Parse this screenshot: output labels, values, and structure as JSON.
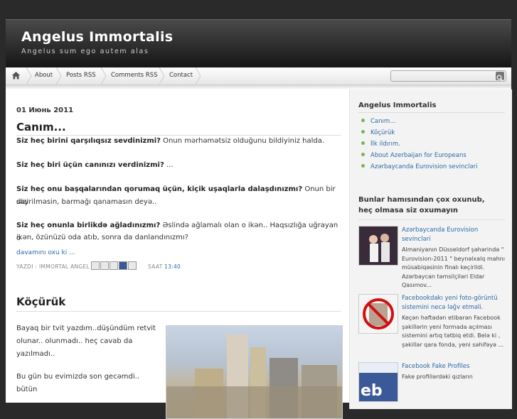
{
  "site": {
    "title": "Angelus Immortalis",
    "tagline": "Angelus sum ego autem alas"
  },
  "nav": {
    "home_icon": "home-icon",
    "items": [
      "About",
      "Posts RSS",
      "Comments RSS",
      "Contact"
    ],
    "search_placeholder": ""
  },
  "posts": [
    {
      "date": "01 Июнь 2011",
      "title": "Canım...",
      "paragraphs": [
        {
          "bold": "Siz heç birini qarşılıqsız sevdinizmi?",
          "text": " Onun mərhəmətsiz olduğunu bildiyiniz halda."
        },
        {
          "bold": "Siz heç biri üçün canınızı verdinizmi?",
          "text": " ..."
        },
        {
          "bold": "Siz heç onu başqalarından qorumaq üçün, kiçik uşaqlarla dalaşdınızmı?",
          "text": " Onun bir dizi"
        },
        {
          "bold": "",
          "text": "səyrilməsin, barmağı qanamasın deyə.."
        },
        {
          "bold": "Siz heç onunla birlikdə ağladınızmı?",
          "text": " Əslində ağlamalı olan o ikən.. Haqsızlığa uğrayan o"
        },
        {
          "bold": "",
          "text": "ikən, özünüzü oda atıb, sonra da danlandınızmı?"
        }
      ],
      "more_link": "davamını oxu ki ...",
      "meta_author": "YAZDI : IMMORTAL ANGEL",
      "meta_saat": "SAAT",
      "meta_time": "13:40"
    },
    {
      "title": "Köçürük",
      "paragraphs": [
        "Bayaq bir tvit yazdım..düşündüm retvit",
        "olunar.. olunmadı.. heç cavab da",
        "yazılmadı..",
        "Bu gün bu evimizdə son gecəmdi.. bütün"
      ]
    }
  ],
  "sidebar": {
    "widget1_title": "Angelus Immortalis",
    "widget1_items": [
      "Canım...",
      "Köçürük",
      "İlk ildırım.",
      "About Azerbaijan for Europeans",
      "Azərbaycanda Eurovision sevincləri"
    ],
    "widget2_title": "Bunlar hamısından çox oxunub, heç olmasa siz oxumayın",
    "popular": [
      {
        "title": "Azərbaycanda Eurovision sevincləri",
        "snippet": "Almaniyanın Düsseldorf şəhərində \" Eurovision-2011 \" beynəlxalq mahnı müsabiqəsinin finalı keçirildi. Azərbaycan təmsilçiləri Eldar Qasımov..."
      },
      {
        "title": "Facebookdakı yeni foto-görüntü sistemini necə ləğv etməli.",
        "snippet": "Keçən həftədən etibarən Facebook şəkillərin yeni formada açılması sistemini artıq tətbiq etdi. Belə ki , şəkillər qara fonda, yeni səhifəyə ..."
      },
      {
        "title": "Facebook Fake Profiles",
        "snippet": "Fake profillərdəki qızların"
      }
    ]
  },
  "colors": {
    "link": "#2d6aa8",
    "header_dark": "#151515",
    "bullet": "#7cb25a"
  }
}
